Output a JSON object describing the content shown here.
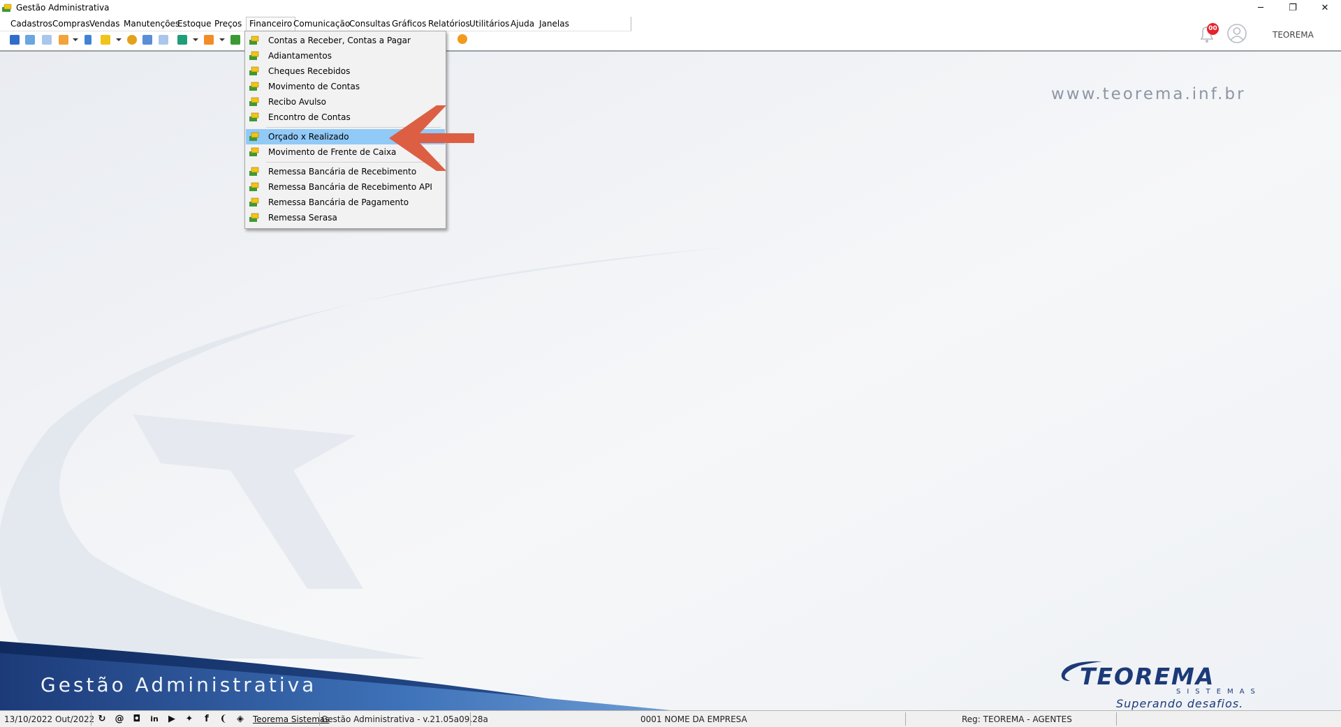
{
  "window": {
    "title": "Gestão Administrativa",
    "controls": {
      "minimize": "─",
      "maximize": "❐",
      "close": "✕"
    }
  },
  "menubar": {
    "items": [
      "Cadastros",
      "Compras",
      "Vendas",
      "Manutenções",
      "Estoque",
      "Preços",
      "Financeiro",
      "Comunicação",
      "Consultas",
      "Gráficos",
      "Relatórios",
      "Utilitários",
      "Ajuda",
      "Janelas"
    ],
    "active": "Financeiro"
  },
  "topright": {
    "notification_count": "00",
    "user_name": "TEOREMA"
  },
  "financeiro_menu": {
    "groups": [
      [
        "Contas a Receber, Contas a Pagar",
        "Adiantamentos",
        "Cheques Recebidos",
        "Movimento de Contas",
        "Recibo Avulso",
        "Encontro de Contas"
      ],
      [
        "Orçado x Realizado",
        "Movimento de Frente de Caixa"
      ],
      [
        "Remessa Bancária de Recebimento",
        "Remessa Bancária de Recebimento API",
        "Remessa Bancária de Pagamento",
        "Remessa Serasa"
      ]
    ],
    "highlighted": "Orçado x Realizado"
  },
  "desktop": {
    "watermark_url": "www.teorema.inf.br",
    "banner_text": "Gestão Administrativa",
    "logo": {
      "name": "TEOREMA",
      "sub": "SISTEMAS",
      "tagline": "Superando desafios."
    }
  },
  "statusbar": {
    "date": "13/10/2022 Out/2022",
    "company_link": "Teorema Sistemas",
    "version": "Gestão Administrativa - v.21.05a09.28a",
    "empresa": "0001 NOME DA EMPRESA",
    "reg": "Reg: TEOREMA - AGENTES"
  },
  "colors": {
    "menu_highlight": "#91c9f7",
    "arrow": "#dc5f44",
    "banner_dark": "#1c3a78",
    "banner_light": "#4f86c6",
    "watermark": "#8c96a4"
  }
}
